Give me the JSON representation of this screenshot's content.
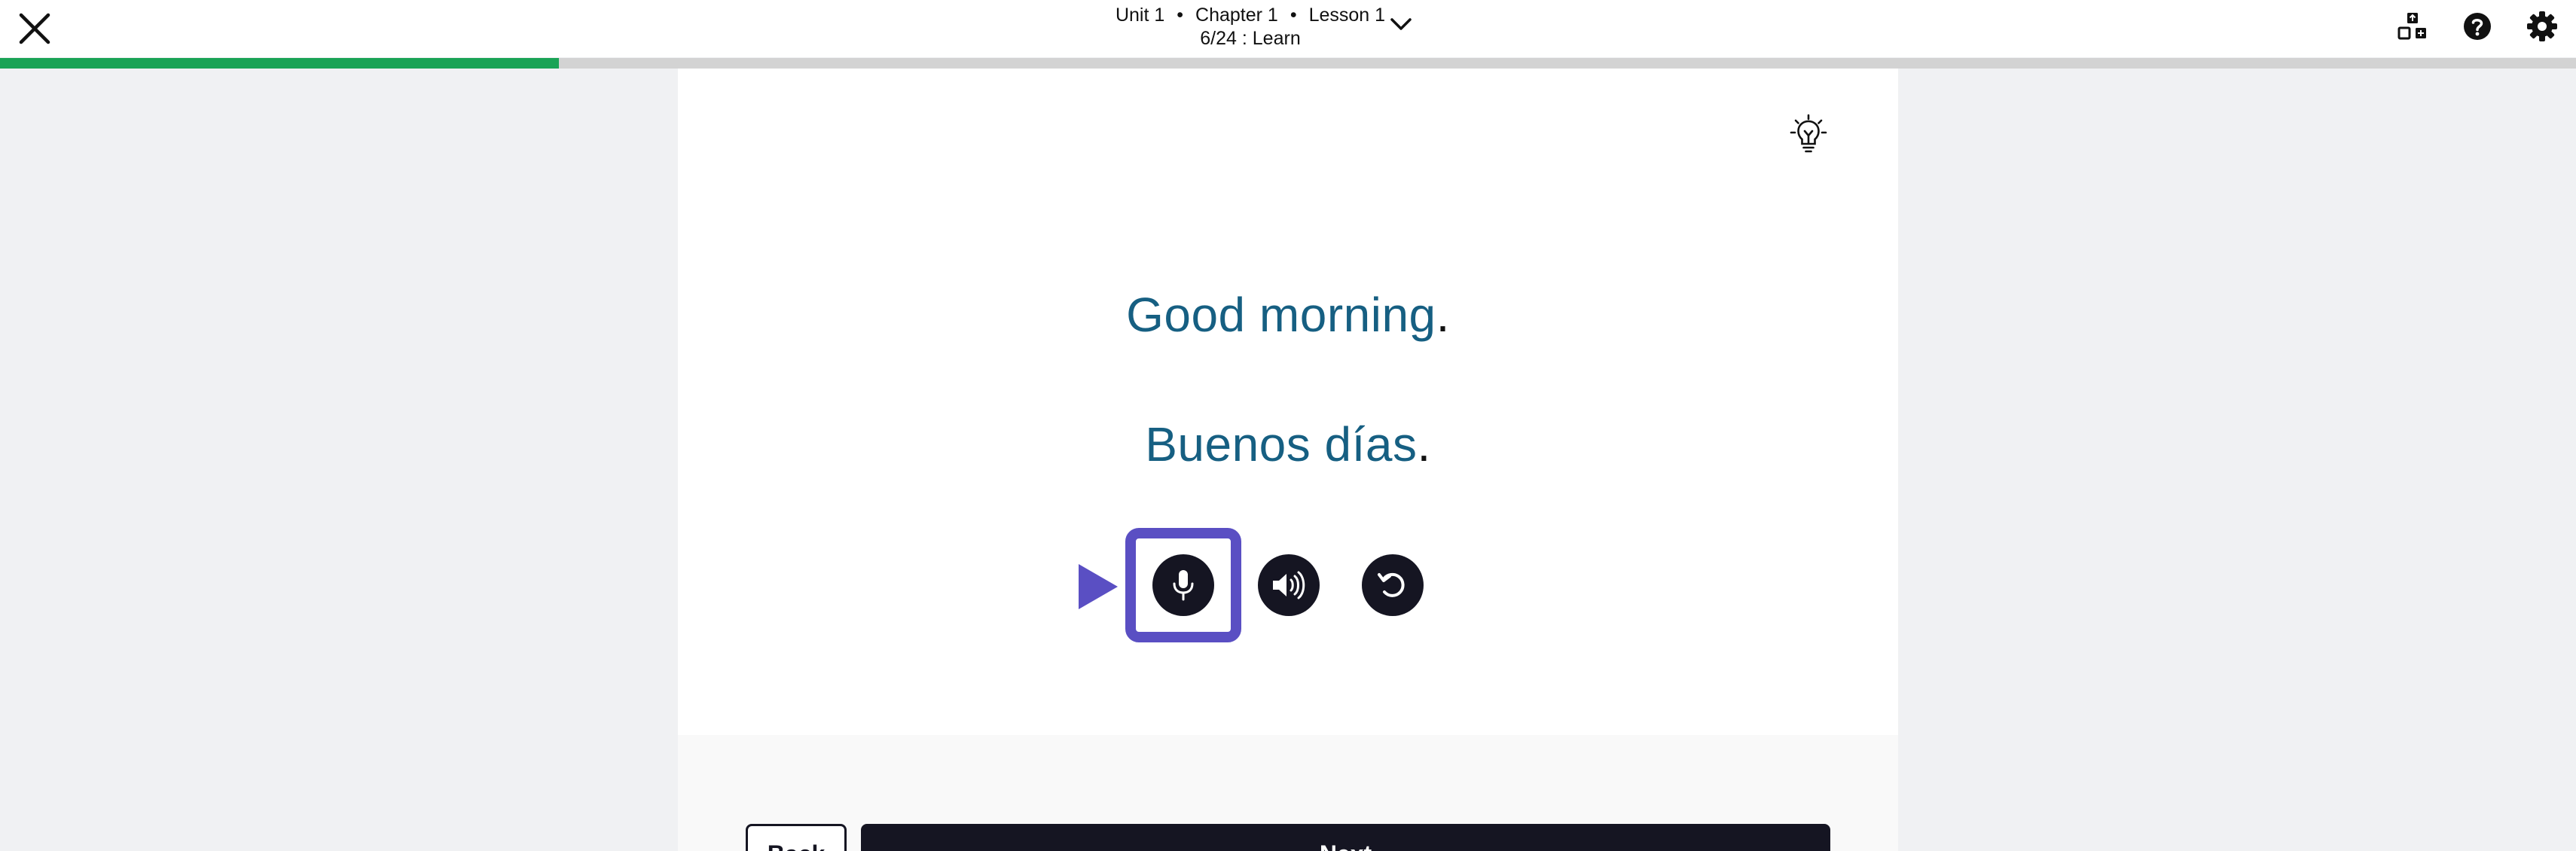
{
  "header": {
    "unit": "Unit 1",
    "chapter": "Chapter 1",
    "lesson": "Lesson 1",
    "step": "6/24 : Learn",
    "separator": "•"
  },
  "progress": {
    "fraction": 0.217,
    "color": "#1aa356"
  },
  "icons": {
    "close": "close-icon",
    "chevron": "chevron-down-icon",
    "contents": "contents-icon",
    "help": "help-icon",
    "settings": "gear-icon",
    "hint": "lightbulb-icon",
    "mic": "microphone-icon",
    "speaker": "speaker-icon",
    "replay": "replay-icon"
  },
  "card": {
    "english": "Good morning",
    "spanish": "Buenos días",
    "period": "."
  },
  "colors": {
    "phrase": "#165f82",
    "accent": "#5a4fc3",
    "dark": "#151522"
  },
  "footer": {
    "back_label": "Back",
    "next_label": "Next"
  }
}
